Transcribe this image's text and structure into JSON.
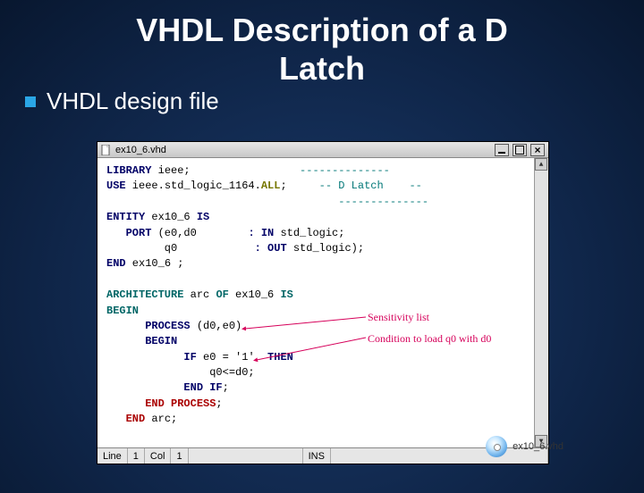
{
  "slide": {
    "title_line1": "VHDL Description of a D",
    "title_line2": "Latch",
    "bullet": "VHDL design file"
  },
  "window": {
    "title": "ex10_6.vhd",
    "status": {
      "line_label": "Line",
      "line_val": "1",
      "col_label": "Col",
      "col_val": "1",
      "mode": "INS"
    }
  },
  "code": {
    "l1_a": "LIBRARY",
    "l1_b": " ieee;",
    "l1_c": "                 --------------",
    "l2_a": "USE",
    "l2_b": " ieee.std_logic_1164.",
    "l2_c": "ALL",
    "l2_d": ";",
    "l2_e": "     -- D Latch    --",
    "l2f": "                                    --------------",
    "l3_a": "ENTITY",
    "l3_b": " ex10_6 ",
    "l3_c": "IS",
    "l4_a": "   PORT ",
    "l4_b": "(e0,d0",
    "l4_c": "        : IN",
    "l4_d": " std_logic;",
    "l5_a": "         q0",
    "l5_b": "            : OUT",
    "l5_c": " std_logic);",
    "l6_a": "END",
    "l6_b": " ex10_6 ;",
    "l7_a": "ARCHITECTURE",
    "l7_b": " arc ",
    "l7_c": "OF",
    "l7_d": " ex10_6 ",
    "l7_e": "IS",
    "l8_a": "BEGIN",
    "l9_a": "      PROCESS ",
    "l9_b": "(d0,e0)",
    "l10_a": "      BEGIN",
    "l11_a": "            IF ",
    "l11_b": "e0 = '1'",
    "l11_c": "  THEN",
    "l12_a": "                q0<=d0;",
    "l13_a": "            END IF",
    "l13_b": ";",
    "l14_a": "      END PROCESS",
    "l14_b": ";",
    "l15_a": "   END",
    "l15_b": " arc;"
  },
  "annotations": {
    "sens": "Sensitivity list",
    "cond": "Condition to load q0 with d0"
  },
  "footer": {
    "cd_label": "ex10_6.vhd"
  }
}
